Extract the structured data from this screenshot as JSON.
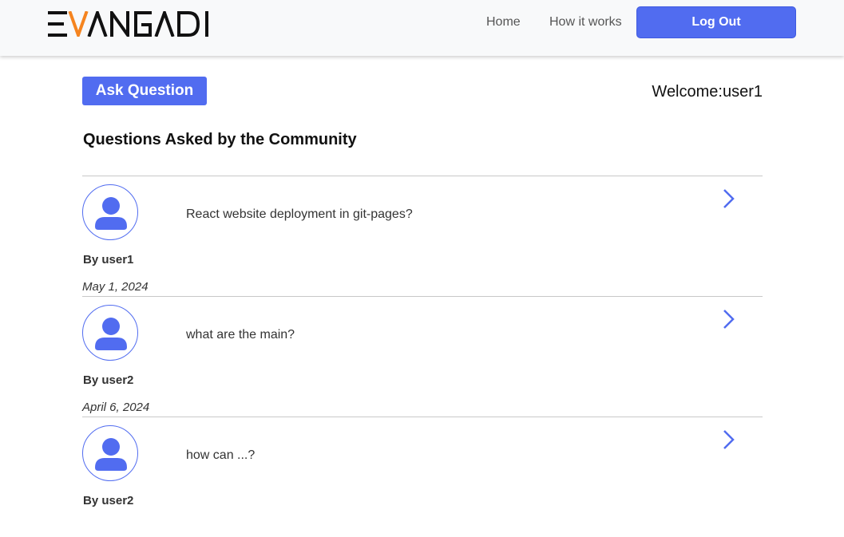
{
  "header": {
    "logo_text": "EVANGADI",
    "nav": [
      {
        "label": "Home"
      },
      {
        "label": "How it works"
      }
    ],
    "logout_label": "Log Out"
  },
  "main": {
    "ask_button_label": "Ask Question",
    "welcome_text": "Welcome:user1",
    "section_title": "Questions Asked by the Community",
    "questions": [
      {
        "title": "React website deployment in git-pages?",
        "user": "By user1",
        "date": "May 1, 2024"
      },
      {
        "title": "what are the main?",
        "user": "By user2",
        "date": "April 6, 2024"
      },
      {
        "title": "how can ...?",
        "user": "By user2",
        "date": ""
      }
    ]
  },
  "colors": {
    "accent": "#516cf0",
    "logo_accent": "#f5841f",
    "header_bg": "#f8f9fa"
  },
  "icons": {
    "avatar": "user-avatar-icon",
    "chevron": "chevron-right-icon"
  }
}
